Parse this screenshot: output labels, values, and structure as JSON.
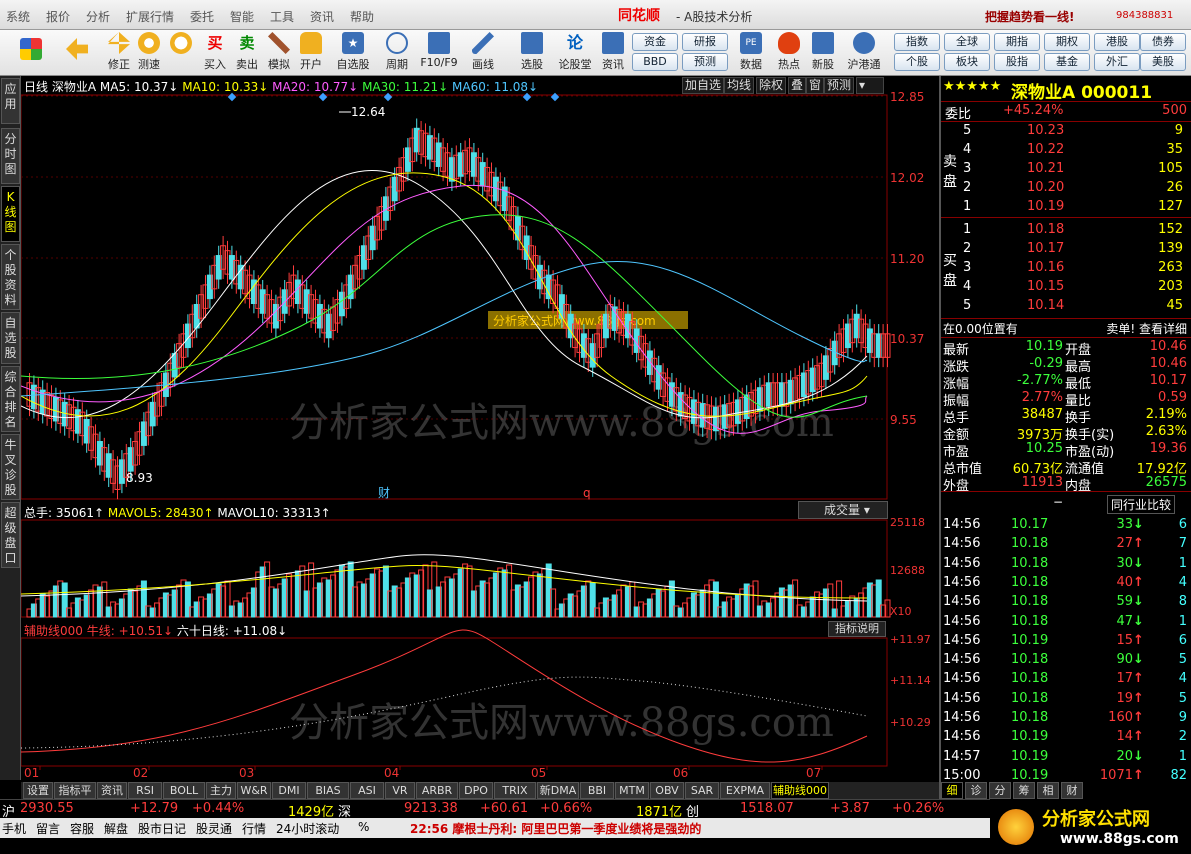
{
  "menu": [
    "系统",
    "报价",
    "分析",
    "扩展行情",
    "委托",
    "智能",
    "工具",
    "资讯",
    "帮助"
  ],
  "brand": "同花顺",
  "app_title": "- A股技术分析",
  "slogan": "把握趋势看一线!",
  "phone": "984388831",
  "toolbar": [
    "修正",
    "测速",
    "买入",
    "卖出",
    "模拟",
    "开户",
    "自选股",
    "周期",
    "F10/F9",
    "画线",
    "选股",
    "论股堂",
    "资讯",
    "数据",
    "热点",
    "新股",
    "沪港通"
  ],
  "quick_buttons": [
    [
      "资金",
      "研报",
      "指数",
      "全球",
      "期指",
      "期权",
      "港股",
      "债券"
    ],
    [
      "BBD",
      "预测",
      "个股",
      "板块",
      "股指",
      "基金",
      "外汇",
      "美股"
    ]
  ],
  "left_tabs": [
    "应用",
    "分时图",
    "K线图",
    "个股资料",
    "自选股",
    "综合排名",
    "牛叉诊股",
    "超级盘口"
  ],
  "chart_info": {
    "period": "日线",
    "name": "深物业A",
    "ma5": "MA5: 10.37↓",
    "ma10": "MA10: 10.33↓",
    "ma20": "MA20: 10.77↓",
    "ma30": "MA30: 11.21↓",
    "ma60": "MA60: 11.08↓"
  },
  "chart_tools": [
    "加自选",
    "均线",
    "除权",
    "叠",
    "窗",
    "预测"
  ],
  "price_axis": [
    "12.85",
    "12.02",
    "11.20",
    "10.37",
    "9.55"
  ],
  "max_label": "12.64",
  "min_label": "8.93",
  "marker_cai": "财",
  "marker_q": "q",
  "vol_info": {
    "total": "总手: 35061↑",
    "mavol5": "MAVOL5: 28430↑",
    "mavol10": "MAVOL10: 33313↑"
  },
  "vol_btn": "成交量",
  "vol_axis": [
    "25118",
    "12688",
    "X10"
  ],
  "ind_info": {
    "name": "辅助线000 牛线: +10.51↓",
    "line60": "六十日线: +11.08↓"
  },
  "ind_btn": "指标说明",
  "ind_axis": [
    "+11.97",
    "+11.14",
    "+10.29"
  ],
  "months": [
    "01",
    "02",
    "03",
    "04",
    "05",
    "06",
    "07"
  ],
  "bottom_tabs": [
    "设置",
    "指标平台",
    "资讯",
    "RSI",
    "BOLL",
    "主力",
    "W&R",
    "DMI",
    "BIAS",
    "ASI",
    "VR",
    "ARBR",
    "DPO",
    "TRIX",
    "新DMA",
    "BBI",
    "MTM",
    "OBV",
    "SAR",
    "EXPMA",
    "辅助线000"
  ],
  "watermark": "分析家公式网www.88gs.com",
  "watermark_small": "分析家公式网www.88gs.com",
  "quote": {
    "stars": "★★★★★",
    "title": "深物业A 000011",
    "weibi_label": "委比",
    "weibi": "+45.24%",
    "weicha": "500",
    "sell_label": "卖\n盘",
    "buy_label": "买\n盘",
    "sell": [
      [
        "5",
        "10.23",
        "9"
      ],
      [
        "4",
        "10.22",
        "35"
      ],
      [
        "3",
        "10.21",
        "105"
      ],
      [
        "2",
        "10.20",
        "26"
      ],
      [
        "1",
        "10.19",
        "127"
      ]
    ],
    "buy": [
      [
        "1",
        "10.18",
        "152"
      ],
      [
        "2",
        "10.17",
        "139"
      ],
      [
        "3",
        "10.16",
        "263"
      ],
      [
        "4",
        "10.15",
        "203"
      ],
      [
        "5",
        "10.14",
        "45"
      ]
    ],
    "pos_note": "在0.00位置有",
    "pos_right": "卖单! 查看详细",
    "stats": [
      [
        "最新",
        "10.19",
        "开盘",
        "10.46"
      ],
      [
        "涨跌",
        "-0.29",
        "最高",
        "10.46"
      ],
      [
        "涨幅",
        "-2.77%",
        "最低",
        "10.17"
      ],
      [
        "振幅",
        "2.77%",
        "量比",
        "0.59"
      ],
      [
        "总手",
        "38487",
        "换手",
        "2.19%"
      ],
      [
        "金额",
        "3973万",
        "换手(实)",
        "2.63%"
      ],
      [
        "市盈",
        "10.25",
        "市盈(动)",
        "19.36"
      ],
      [
        "总市值",
        "60.73亿",
        "流通值",
        "17.92亿"
      ],
      [
        "外盘",
        "11913",
        "内盘",
        "26575"
      ]
    ],
    "peer": "同行业比较",
    "ticks": [
      [
        "14:56",
        "10.17",
        "33",
        "↓",
        "6"
      ],
      [
        "14:56",
        "10.18",
        "27",
        "↑",
        "7"
      ],
      [
        "14:56",
        "10.18",
        "30",
        "↓",
        "1"
      ],
      [
        "14:56",
        "10.18",
        "40",
        "↑",
        "4"
      ],
      [
        "14:56",
        "10.18",
        "59",
        "↓",
        "8"
      ],
      [
        "14:56",
        "10.18",
        "47",
        "↓",
        "1"
      ],
      [
        "14:56",
        "10.19",
        "15",
        "↑",
        "6"
      ],
      [
        "14:56",
        "10.18",
        "90",
        "↓",
        "5"
      ],
      [
        "14:56",
        "10.18",
        "17",
        "↑",
        "4"
      ],
      [
        "14:56",
        "10.18",
        "19",
        "↑",
        "5"
      ],
      [
        "14:56",
        "10.18",
        "160",
        "↑",
        "9"
      ],
      [
        "14:56",
        "10.19",
        "14",
        "↑",
        "2"
      ],
      [
        "14:57",
        "10.19",
        "20",
        "↓",
        "1"
      ],
      [
        "15:00",
        "10.19",
        "1071",
        "↑",
        "82"
      ]
    ],
    "right_tabs": [
      "细",
      "诊",
      "分",
      "筹",
      "相",
      "财"
    ]
  },
  "status": {
    "sh": "沪",
    "sh_idx": "2930.55",
    "sh_chg": "+12.79",
    "sh_pct": "+0.44%",
    "sh_amt": "1429亿",
    "sz": "深",
    "sz_idx": "9213.38",
    "sz_chg": "+60.61",
    "sz_pct": "+0.66%",
    "sz_amt": "1871亿",
    "cy": "创",
    "cy_idx": "1518.07",
    "cy_chg": "+3.87",
    "cy_pct": "+0.26%"
  },
  "foot": {
    "items": [
      "手机",
      "留言",
      "容服",
      "解盘",
      "股市日记",
      "股灵通",
      "行情",
      "24小时滚动",
      "%"
    ],
    "news": "22:56 摩根士丹利: 阿里巴巴第一季度业绩将是强劲的"
  },
  "logo": {
    "text": "分析家公式网",
    "url": "www.88gs.com"
  }
}
